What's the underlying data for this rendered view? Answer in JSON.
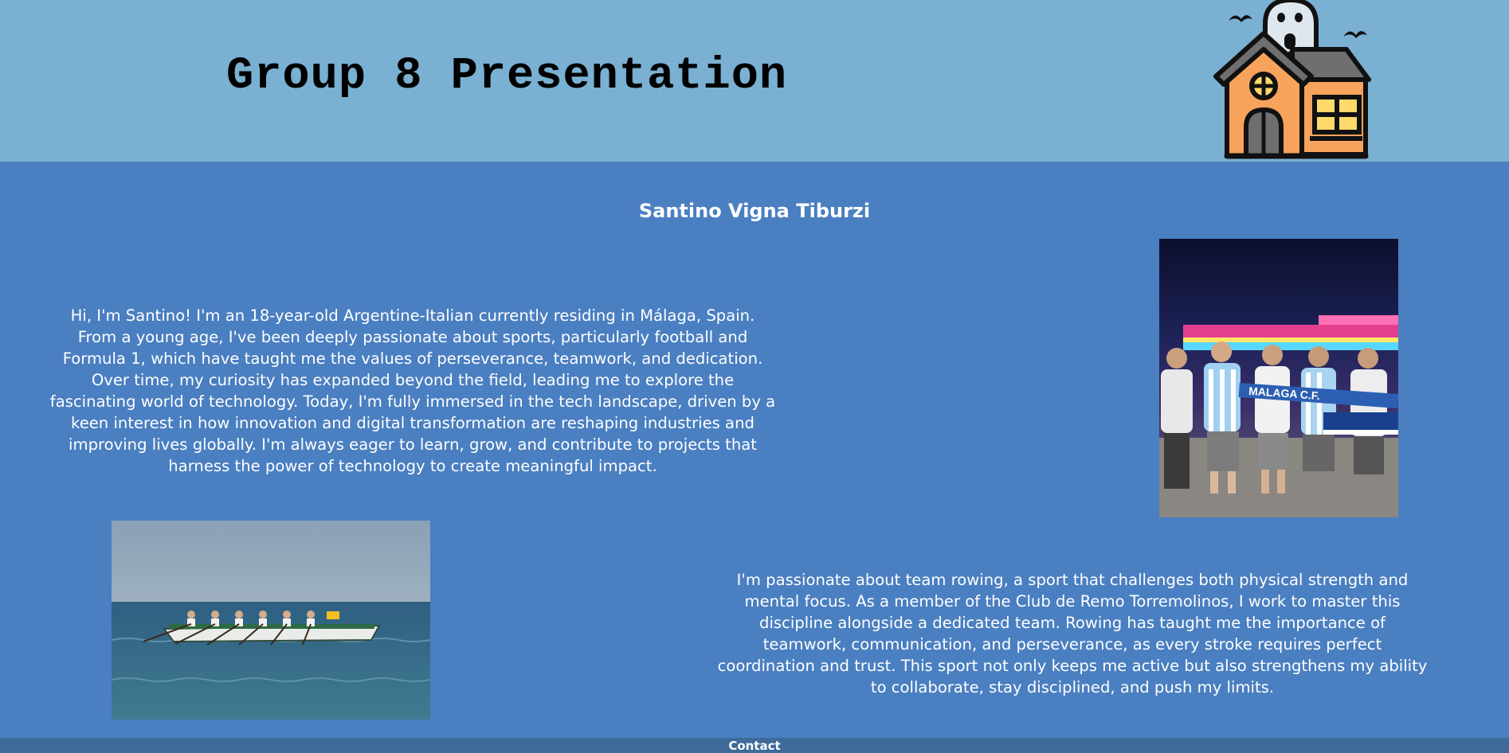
{
  "header": {
    "title": "Group 8 Presentation",
    "logo_icon": "haunted-house-icon"
  },
  "profile": {
    "name": "Santino Vigna Tiburzi",
    "bio": "Hi, I'm Santino! I'm an 18-year-old Argentine-Italian currently residing in Málaga, Spain. From a young age, I've been deeply passionate about sports, particularly football and Formula 1, which have taught me the values of perseverance, teamwork, and dedication. Over time, my curiosity has expanded beyond the field, leading me to explore the fascinating world of technology. Today, I'm fully immersed in the tech landscape, driven by a keen interest in how innovation and digital transformation are reshaping industries and improving lives globally. I'm always eager to learn, grow, and contribute to projects that harness the power of technology to create meaningful impact.",
    "rowing": "I'm passionate about team rowing, a sport that challenges both physical strength and mental focus. As a member of the Club de Remo Torremolinos, I work to master this discipline alongside a dedicated team. Rowing has taught me the importance of teamwork, communication, and perseverance, as every stroke requires perfect coordination and trust. This sport not only keeps me active but also strengthens my ability to collaborate, stay disciplined, and push my limits.",
    "scarf_text": "MALAGA C.F."
  },
  "footer": {
    "contact_label": "Contact"
  },
  "colors": {
    "header_bg": "#7ab0d2",
    "main_bg": "#4a7fc1",
    "footer_bg": "#3d6a99",
    "text": "#ffffff"
  }
}
